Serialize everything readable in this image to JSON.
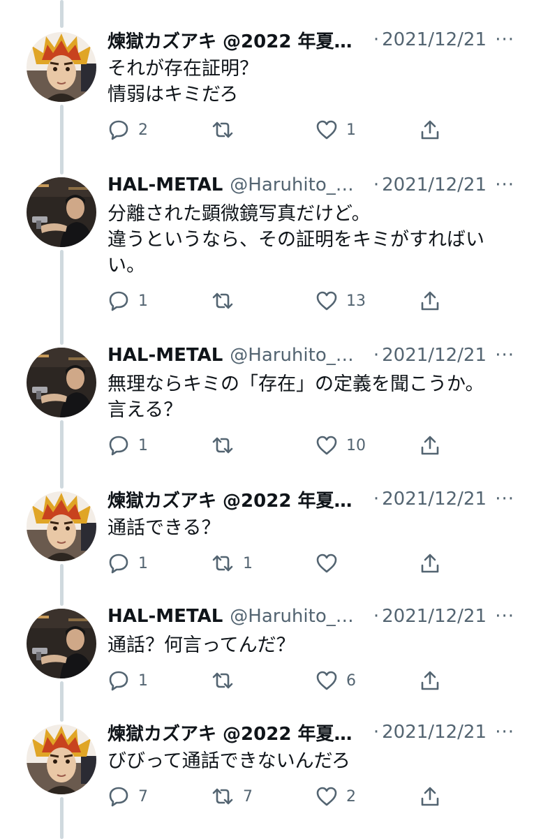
{
  "tweets": [
    {
      "author": "kazuaki",
      "name": "煉獄カズアキ @2022 年夏…",
      "handle": "",
      "separator": "·",
      "date": "2021/12/21",
      "more": "···",
      "lines": [
        "それが存在証明？",
        "情弱はキミだろ"
      ],
      "replies": "2",
      "retweets": "",
      "likes": "1"
    },
    {
      "author": "hal",
      "name": "HAL-METAL",
      "handle": "@Haruhito_…",
      "separator": "·",
      "date": "2021/12/21",
      "more": "···",
      "lines": [
        "分離された顕微鏡写真だけど。",
        "違うというなら、その証明をキミがすればい",
        "い。"
      ],
      "replies": "1",
      "retweets": "",
      "likes": "13"
    },
    {
      "author": "hal",
      "name": "HAL-METAL",
      "handle": "@Haruhito_…",
      "separator": "·",
      "date": "2021/12/21",
      "more": "···",
      "lines": [
        "無理ならキミの「存在」の定義を聞こうか。",
        "言える？"
      ],
      "replies": "1",
      "retweets": "",
      "likes": "10"
    },
    {
      "author": "kazuaki",
      "name": "煉獄カズアキ @2022 年夏…",
      "handle": "",
      "separator": "·",
      "date": "2021/12/21",
      "more": "···",
      "lines": [
        "通話できる？"
      ],
      "replies": "1",
      "retweets": "1",
      "likes": ""
    },
    {
      "author": "hal",
      "name": "HAL-METAL",
      "handle": "@Haruhito_…",
      "separator": "·",
      "date": "2021/12/21",
      "more": "···",
      "lines": [
        "通話？何言ってんだ？"
      ],
      "replies": "1",
      "retweets": "",
      "likes": "6"
    },
    {
      "author": "kazuaki",
      "name": "煉獄カズアキ @2022 年夏…",
      "handle": "",
      "separator": "·",
      "date": "2021/12/21",
      "more": "···",
      "lines": [
        "びびって通話できないんだろ"
      ],
      "replies": "7",
      "retweets": "7",
      "likes": "2"
    }
  ],
  "icons": [
    "reply-icon",
    "retweet-icon",
    "like-icon",
    "share-icon",
    "more-icon"
  ],
  "colors": {
    "text": "#0f1419",
    "secondary": "#536471",
    "thread_line": "#cfd9de"
  }
}
